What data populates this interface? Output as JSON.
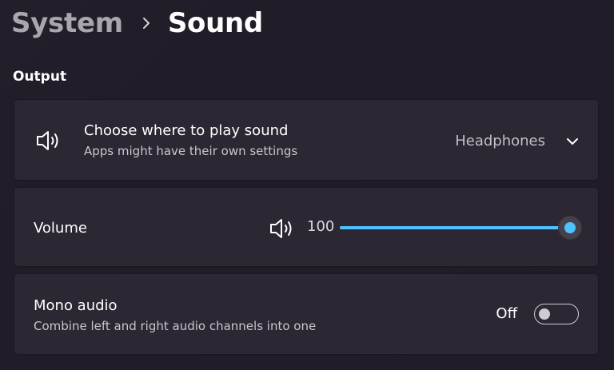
{
  "breadcrumb": {
    "parent": "System",
    "current": "Sound"
  },
  "section": {
    "title": "Output"
  },
  "output_device": {
    "title": "Choose where to play sound",
    "subtitle": "Apps might have their own settings",
    "selected": "Headphones",
    "icon": "speaker-icon"
  },
  "volume": {
    "label": "Volume",
    "value_text": "100",
    "level": 100,
    "icon": "speaker-icon",
    "accent": "#4cc2ff"
  },
  "mono_audio": {
    "title": "Mono audio",
    "subtitle": "Combine left and right audio channels into one",
    "state_label": "Off",
    "enabled": false
  }
}
